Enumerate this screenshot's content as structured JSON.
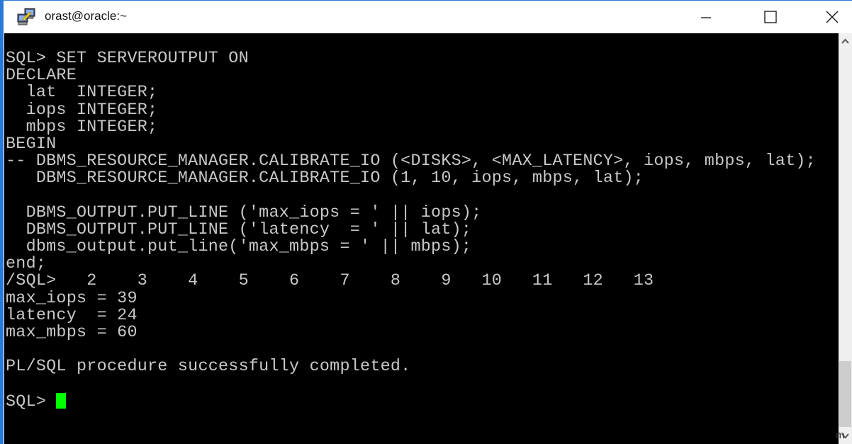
{
  "window": {
    "title": "orast@oracle:~",
    "icon": "putty-icon",
    "controls": {
      "minimize": "minimize-icon",
      "maximize": "maximize-icon",
      "close": "close-icon"
    }
  },
  "terminal": {
    "lines": [
      "SQL> SET SERVEROUTPUT ON",
      "DECLARE",
      "  lat  INTEGER;",
      "  iops INTEGER;",
      "  mbps INTEGER;",
      "BEGIN",
      "-- DBMS_RESOURCE_MANAGER.CALIBRATE_IO (<DISKS>, <MAX_LATENCY>, iops, mbps, lat);",
      "   DBMS_RESOURCE_MANAGER.CALIBRATE_IO (1, 10, iops, mbps, lat);",
      "",
      "  DBMS_OUTPUT.PUT_LINE ('max_iops = ' || iops);",
      "  DBMS_OUTPUT.PUT_LINE ('latency  = ' || lat);",
      "  dbms_output.put_line('max_mbps = ' || mbps);",
      "end;",
      "/SQL>   2    3    4    5    6    7    8    9   10   11   12   13",
      "max_iops = 39",
      "latency  = 24",
      "max_mbps = 60",
      "",
      "PL/SQL procedure successfully completed.",
      ""
    ],
    "prompt": "SQL> ",
    "cursor_color": "#00ff00",
    "text_color": "#c8c8c8",
    "background": "#000000"
  },
  "scrollbar": {
    "up_icon": "chevron-up-icon",
    "down_icon": "chevron-down-icon",
    "position_fraction": 0.9
  },
  "overlay_fragment": "m"
}
